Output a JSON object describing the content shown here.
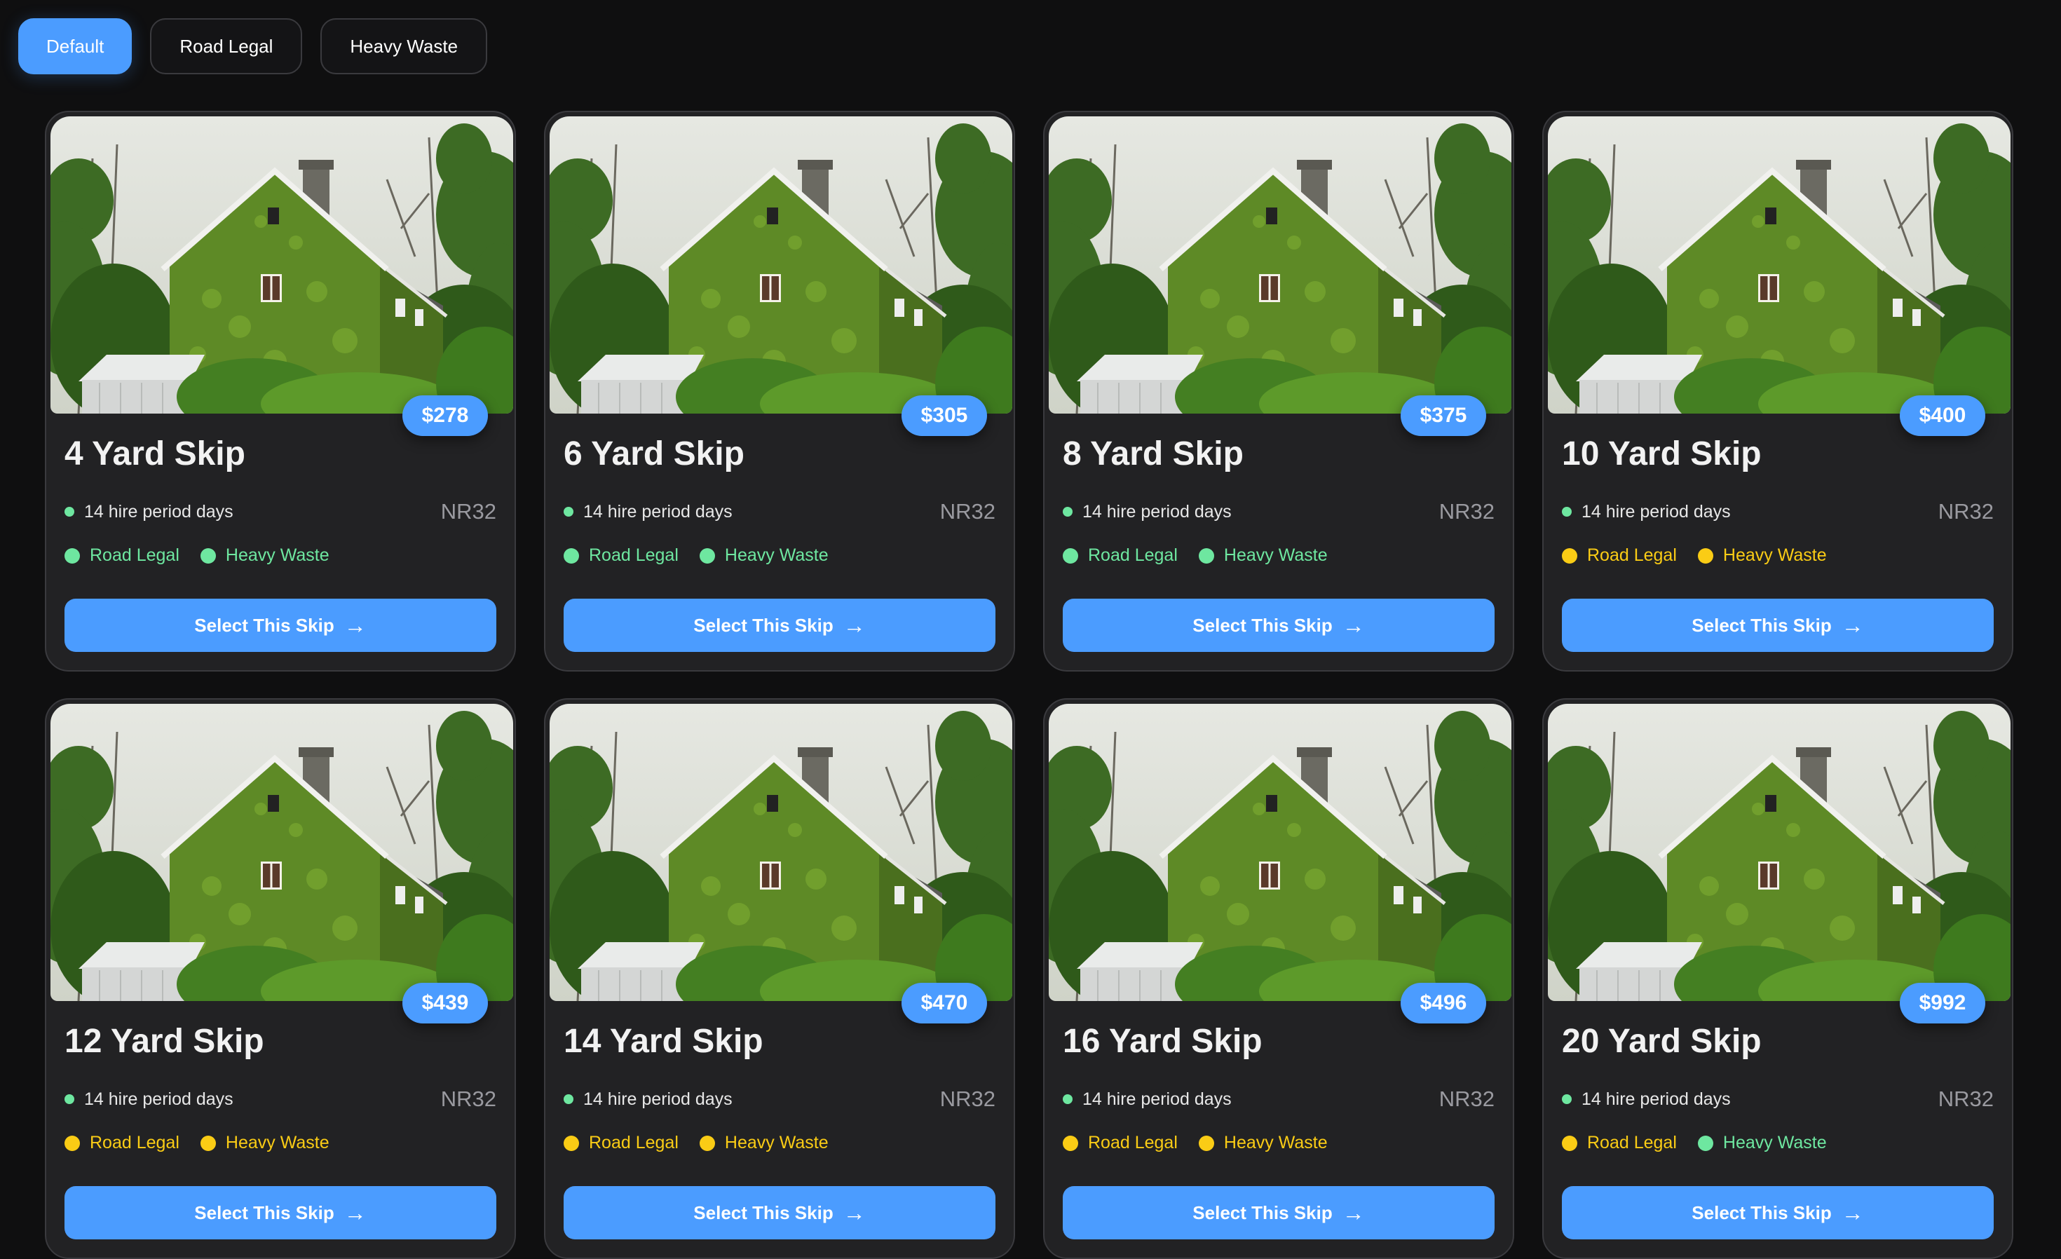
{
  "filters": [
    {
      "label": "Default",
      "active": true
    },
    {
      "label": "Road Legal",
      "active": false
    },
    {
      "label": "Heavy Waste",
      "active": false
    }
  ],
  "cards": [
    {
      "title": "4 Yard Skip",
      "price": "$278",
      "hire": "14 hire period days",
      "postcode": "NR32",
      "tag1": "Road Legal",
      "tag1_status": "green",
      "tag2": "Heavy Waste",
      "tag2_status": "green",
      "button": "Select This Skip"
    },
    {
      "title": "6 Yard Skip",
      "price": "$305",
      "hire": "14 hire period days",
      "postcode": "NR32",
      "tag1": "Road Legal",
      "tag1_status": "green",
      "tag2": "Heavy Waste",
      "tag2_status": "green",
      "button": "Select This Skip"
    },
    {
      "title": "8 Yard Skip",
      "price": "$375",
      "hire": "14 hire period days",
      "postcode": "NR32",
      "tag1": "Road Legal",
      "tag1_status": "green",
      "tag2": "Heavy Waste",
      "tag2_status": "green",
      "button": "Select This Skip"
    },
    {
      "title": "10 Yard Skip",
      "price": "$400",
      "hire": "14 hire period days",
      "postcode": "NR32",
      "tag1": "Road Legal",
      "tag1_status": "yellow",
      "tag2": "Heavy Waste",
      "tag2_status": "yellow",
      "button": "Select This Skip"
    },
    {
      "title": "12 Yard Skip",
      "price": "$439",
      "hire": "14 hire period days",
      "postcode": "NR32",
      "tag1": "Road Legal",
      "tag1_status": "yellow",
      "tag2": "Heavy Waste",
      "tag2_status": "yellow",
      "button": "Select This Skip"
    },
    {
      "title": "14 Yard Skip",
      "price": "$470",
      "hire": "14 hire period days",
      "postcode": "NR32",
      "tag1": "Road Legal",
      "tag1_status": "yellow",
      "tag2": "Heavy Waste",
      "tag2_status": "yellow",
      "button": "Select This Skip"
    },
    {
      "title": "16 Yard Skip",
      "price": "$496",
      "hire": "14 hire period days",
      "postcode": "NR32",
      "tag1": "Road Legal",
      "tag1_status": "yellow",
      "tag2": "Heavy Waste",
      "tag2_status": "yellow",
      "button": "Select This Skip"
    },
    {
      "title": "20 Yard Skip",
      "price": "$992",
      "hire": "14 hire period days",
      "postcode": "NR32",
      "tag1": "Road Legal",
      "tag1_status": "yellow",
      "tag2": "Heavy Waste",
      "tag2_status": "green",
      "button": "Select This Skip"
    }
  ],
  "colors": {
    "accent": "#4b9cff",
    "status_green": "#6ee7a0",
    "status_yellow": "#facc15",
    "background": "#0f0f10",
    "card": "#222224"
  },
  "icons": {
    "button_arrow": "→"
  }
}
